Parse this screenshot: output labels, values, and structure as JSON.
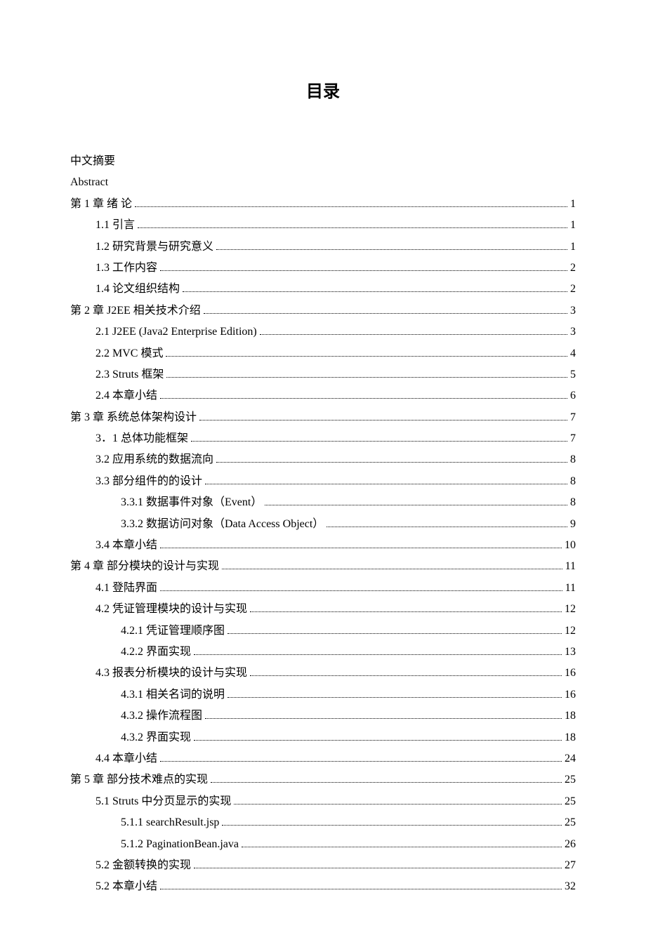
{
  "title": "目录",
  "entries": [
    {
      "label": "中文摘要",
      "page": "",
      "level": 0,
      "hasPage": false
    },
    {
      "label": "Abstract",
      "page": "",
      "level": 0,
      "hasPage": false
    },
    {
      "label": "第 1 章  绪    论",
      "page": "1",
      "level": 0,
      "hasPage": true
    },
    {
      "label": "1.1  引言",
      "page": "1",
      "level": 1,
      "hasPage": true
    },
    {
      "label": "1.2 研究背景与研究意义",
      "page": "1",
      "level": 1,
      "hasPage": true
    },
    {
      "label": "1.3 工作内容",
      "page": "2",
      "level": 1,
      "hasPage": true
    },
    {
      "label": "1.4  论文组织结构",
      "page": "2",
      "level": 1,
      "hasPage": true
    },
    {
      "label": "第 2 章  J2EE 相关技术介绍",
      "page": "3",
      "level": 0,
      "hasPage": true
    },
    {
      "label": "2.1 J2EE (Java2 Enterprise Edition)",
      "page": "3",
      "level": 1,
      "hasPage": true
    },
    {
      "label": "2.2 MVC  模式",
      "page": "4",
      "level": 1,
      "hasPage": true
    },
    {
      "label": "2.3 Struts 框架",
      "page": "5",
      "level": 1,
      "hasPage": true
    },
    {
      "label": "2.4  本章小结",
      "page": "6",
      "level": 1,
      "hasPage": true
    },
    {
      "label": "第 3 章  系统总体架构设计",
      "page": "7",
      "level": 0,
      "hasPage": true
    },
    {
      "label": "3．1 总体功能框架",
      "page": "7",
      "level": 1,
      "hasPage": true
    },
    {
      "label": "3.2  应用系统的数据流向",
      "page": "8",
      "level": 1,
      "hasPage": true
    },
    {
      "label": "3.3  部分组件的的设计",
      "page": "8",
      "level": 1,
      "hasPage": true
    },
    {
      "label": "3.3.1 数据事件对象（Event）",
      "page": "8",
      "level": 2,
      "hasPage": true
    },
    {
      "label": "3.3.2 数据访问对象（Data Access Object）",
      "page": "9",
      "level": 2,
      "hasPage": true
    },
    {
      "label": "3.4  本章小结",
      "page": "10",
      "level": 1,
      "hasPage": true
    },
    {
      "label": "第 4 章  部分模块的设计与实现",
      "page": "11",
      "level": 0,
      "hasPage": true
    },
    {
      "label": "4.1  登陆界面",
      "page": "11",
      "level": 1,
      "hasPage": true
    },
    {
      "label": "4.2  凭证管理模块的设计与实现",
      "page": "12",
      "level": 1,
      "hasPage": true
    },
    {
      "label": "4.2.1 凭证管理顺序图",
      "page": "12",
      "level": 2,
      "hasPage": true
    },
    {
      "label": "4.2.2 界面实现",
      "page": "13",
      "level": 2,
      "hasPage": true
    },
    {
      "label": "4.3  报表分析模块的设计与实现",
      "page": "16",
      "level": 1,
      "hasPage": true
    },
    {
      "label": "4.3.1  相关名词的说明",
      "page": "16",
      "level": 2,
      "hasPage": true
    },
    {
      "label": "4.3.2 操作流程图",
      "page": "18",
      "level": 2,
      "hasPage": true
    },
    {
      "label": "4.3.2 界面实现",
      "page": "18",
      "level": 2,
      "hasPage": true
    },
    {
      "label": "4.4  本章小结",
      "page": "24",
      "level": 1,
      "hasPage": true
    },
    {
      "label": "第 5 章  部分技术难点的实现",
      "page": "25",
      "level": 0,
      "hasPage": true
    },
    {
      "label": "5.1 Struts 中分页显示的实现",
      "page": "25",
      "level": 1,
      "hasPage": true
    },
    {
      "label": "5.1.1 searchResult.jsp",
      "page": "25",
      "level": 2,
      "hasPage": true
    },
    {
      "label": "5.1.2 PaginationBean.java",
      "page": "26",
      "level": 2,
      "hasPage": true
    },
    {
      "label": "5.2  金额转换的实现",
      "page": "27",
      "level": 1,
      "hasPage": true
    },
    {
      "label": "5.2  本章小结",
      "page": "32",
      "level": 1,
      "hasPage": true
    }
  ]
}
